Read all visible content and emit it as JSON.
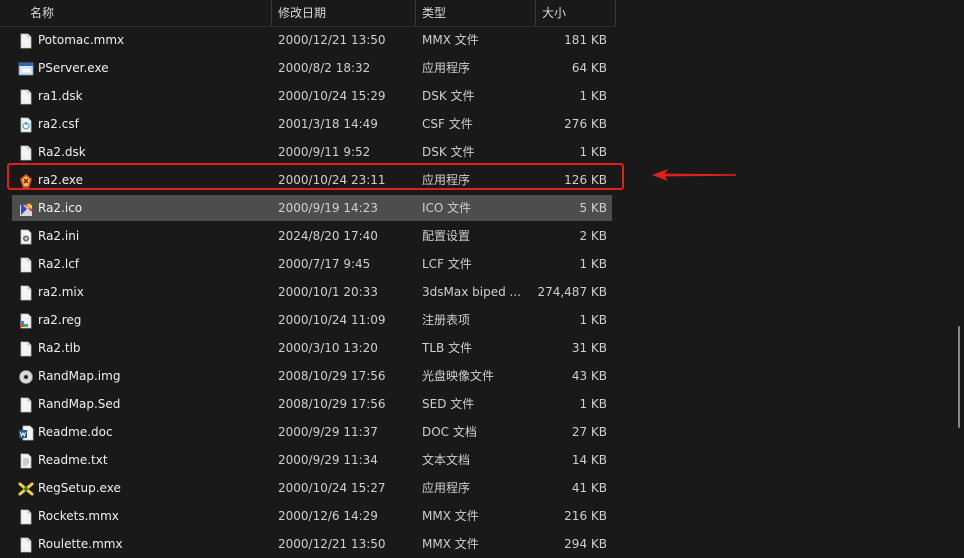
{
  "colors": {
    "background": "#191919",
    "selected_row": "#4d4d4d",
    "highlight_box": "#e0201c",
    "arrow": "#e0201c",
    "text": "#f0f0f0",
    "text_muted": "#cfcfcf"
  },
  "columns": {
    "name": "名称",
    "date": "修改日期",
    "type": "类型",
    "size": "大小"
  },
  "files": [
    {
      "name": "Potomac.mmx",
      "date": "2000/12/21 13:50",
      "type": "MMX 文件",
      "size": "181 KB",
      "icon": "blank-file-icon"
    },
    {
      "name": "PServer.exe",
      "date": "2000/8/2 18:32",
      "type": "应用程序",
      "size": "64 KB",
      "icon": "app-window-icon"
    },
    {
      "name": "ra1.dsk",
      "date": "2000/10/24 15:29",
      "type": "DSK 文件",
      "size": "1 KB",
      "icon": "blank-file-icon"
    },
    {
      "name": "ra2.csf",
      "date": "2001/3/18 14:49",
      "type": "CSF 文件",
      "size": "276 KB",
      "icon": "csf-file-icon"
    },
    {
      "name": "Ra2.dsk",
      "date": "2000/9/11 9:52",
      "type": "DSK 文件",
      "size": "1 KB",
      "icon": "blank-file-icon"
    },
    {
      "name": "ra2.exe",
      "date": "2000/10/24 23:11",
      "type": "应用程序",
      "size": "126 KB",
      "icon": "ra2-app-icon"
    },
    {
      "name": "Ra2.ico",
      "date": "2000/9/19 14:23",
      "type": "ICO 文件",
      "size": "5 KB",
      "icon": "ra2-ico-icon"
    },
    {
      "name": "Ra2.ini",
      "date": "2024/8/20 17:40",
      "type": "配置设置",
      "size": "2 KB",
      "icon": "settings-file-icon"
    },
    {
      "name": "Ra2.lcf",
      "date": "2000/7/17 9:45",
      "type": "LCF 文件",
      "size": "1 KB",
      "icon": "blank-file-icon"
    },
    {
      "name": "ra2.mix",
      "date": "2000/10/1 20:33",
      "type": "3dsMax biped ...",
      "size": "274,487 KB",
      "icon": "blank-file-icon"
    },
    {
      "name": "ra2.reg",
      "date": "2000/10/24 11:09",
      "type": "注册表项",
      "size": "1 KB",
      "icon": "registry-file-icon"
    },
    {
      "name": "Ra2.tlb",
      "date": "2000/3/10 13:20",
      "type": "TLB 文件",
      "size": "31 KB",
      "icon": "blank-file-icon"
    },
    {
      "name": "RandMap.img",
      "date": "2008/10/29 17:56",
      "type": "光盘映像文件",
      "size": "43 KB",
      "icon": "disc-image-icon"
    },
    {
      "name": "RandMap.Sed",
      "date": "2008/10/29 17:56",
      "type": "SED 文件",
      "size": "1 KB",
      "icon": "blank-file-icon"
    },
    {
      "name": "Readme.doc",
      "date": "2000/9/29 11:37",
      "type": "DOC 文档",
      "size": "27 KB",
      "icon": "word-doc-icon"
    },
    {
      "name": "Readme.txt",
      "date": "2000/9/29 11:34",
      "type": "文本文档",
      "size": "14 KB",
      "icon": "text-file-icon"
    },
    {
      "name": "RegSetup.exe",
      "date": "2000/10/24 15:27",
      "type": "应用程序",
      "size": "41 KB",
      "icon": "regsetup-app-icon"
    },
    {
      "name": "Rockets.mmx",
      "date": "2000/12/6 14:29",
      "type": "MMX 文件",
      "size": "216 KB",
      "icon": "blank-file-icon"
    },
    {
      "name": "Roulette.mmx",
      "date": "2000/12/21 13:50",
      "type": "MMX 文件",
      "size": "294 KB",
      "icon": "blank-file-icon"
    }
  ],
  "selected_index": 6,
  "highlighted_index": 5
}
